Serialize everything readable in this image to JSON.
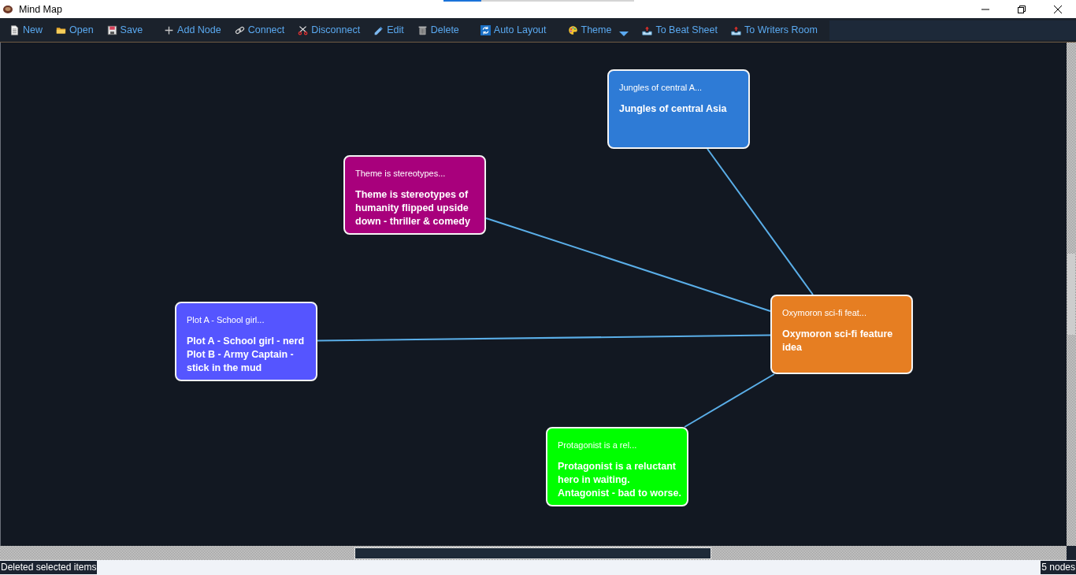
{
  "window": {
    "title": "Mind Map"
  },
  "loading_bar": {
    "level": 0.2
  },
  "toolbar": [
    {
      "label": "New",
      "dropdown": false
    },
    {
      "label": "Open",
      "dropdown": false
    },
    {
      "label": "Save",
      "dropdown": false
    },
    {
      "label": "Add Node",
      "dropdown": false
    },
    {
      "label": "Connect",
      "dropdown": false
    },
    {
      "label": "Disconnect",
      "dropdown": false
    },
    {
      "label": "Edit",
      "dropdown": false
    },
    {
      "label": "Delete",
      "dropdown": false
    },
    {
      "label": "Auto Layout",
      "dropdown": false
    },
    {
      "label": "Theme",
      "dropdown": true
    },
    {
      "label": "To Beat Sheet",
      "dropdown": false
    },
    {
      "label": "To Writers Room",
      "dropdown": false
    }
  ],
  "mind_map": {
    "root": {
      "title": "Oxymoron sci-fi feat...",
      "text": "Oxymoron sci-fi feature idea",
      "color": "#e67e22",
      "children": [
        {
          "title": "Jungles of central A...",
          "text": "Jungles of central Asia",
          "color": "#2e7bd6"
        },
        {
          "title": "Theme is stereotypes...",
          "text": "Theme is stereotypes of humanity flipped upside down - thriller & comedy",
          "color": "#a8007c"
        },
        {
          "title": "Plot A - School girl...",
          "text": "Plot A - School girl - nerd Plot B - Army Captain - stick in the mud",
          "color": "#5555ff"
        },
        {
          "title": "Protagonist is a rel...",
          "text": "Protagonist is a reluctant hero in waiting. Antagonist - bad to worse.",
          "color": "#00ff00"
        }
      ]
    }
  },
  "status_bar": {
    "message": "Deleted selected items",
    "node_count": "5 nodes"
  }
}
